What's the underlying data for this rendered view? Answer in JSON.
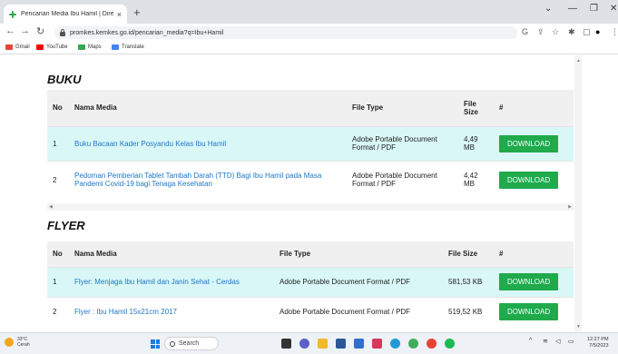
{
  "browser": {
    "tab_title": "Pencarian Media Ibu Hamil | Dire",
    "tab_close": "×",
    "new_tab": "+",
    "url": "promkes.kemkes.go.id/pencarian_media?q=Ibu+Hamil",
    "bookmarks": [
      {
        "label": "Gmail",
        "color": "#ea4335"
      },
      {
        "label": "YouTube",
        "color": "#ff0000"
      },
      {
        "label": "Maps",
        "color": "#34a853"
      },
      {
        "label": "Translate",
        "color": "#4285f4"
      }
    ]
  },
  "buku": {
    "title": "BUKU",
    "headers": {
      "no": "No",
      "nama": "Nama Media",
      "type": "File Type",
      "size_l1": "File",
      "size_l2": "Size",
      "action": "#"
    },
    "rows": [
      {
        "no": "1",
        "nama": "Buku Bacaan Kader Posyandu Kelas Ibu Hamil",
        "type_l1": "Adobe Portable Document",
        "type_l2": "Format / PDF",
        "size_l1": "4,49",
        "size_l2": "MB",
        "button": "DOWNLOAD"
      },
      {
        "no": "2",
        "nama_l1": "Pedoman Pemberian Tablet Tambah Darah (TTD) Bagi Ibu Hamil pada Masa",
        "nama_l2": "Pandemi Covid-19 bagi Tenaga Kesehatan",
        "type_l1": "Adobe Portable Document",
        "type_l2": "Format / PDF",
        "size_l1": "4,42",
        "size_l2": "MB",
        "button": "DOWNLOAD"
      }
    ]
  },
  "flyer": {
    "title": "FLYER",
    "headers": {
      "no": "No",
      "nama": "Nama Media",
      "type": "File Type",
      "size": "File Size",
      "action": "#"
    },
    "rows": [
      {
        "no": "1",
        "nama": "Flyer: Menjaga Ibu Hamil dan Janin Sehat - Cerdas",
        "type": "Adobe Portable Document Format / PDF",
        "size": "581,53 KB",
        "button": "DOWNLOAD"
      },
      {
        "no": "2",
        "nama": "Flyer : Ibu Hamil 15x21cm 2017",
        "type": "Adobe Portable Document Format / PDF",
        "size": "519,52 KB",
        "button": "DOWNLOAD"
      }
    ]
  },
  "taskbar": {
    "weather_temp": "33°C",
    "weather_desc": "Cerah",
    "search_label": "Search",
    "time": "12:27 PM",
    "date": "7/5/2023"
  },
  "colors": {
    "accent_green": "#1faa4c",
    "row_highlight": "#d9f7f7",
    "link_blue": "#1e78c8"
  }
}
